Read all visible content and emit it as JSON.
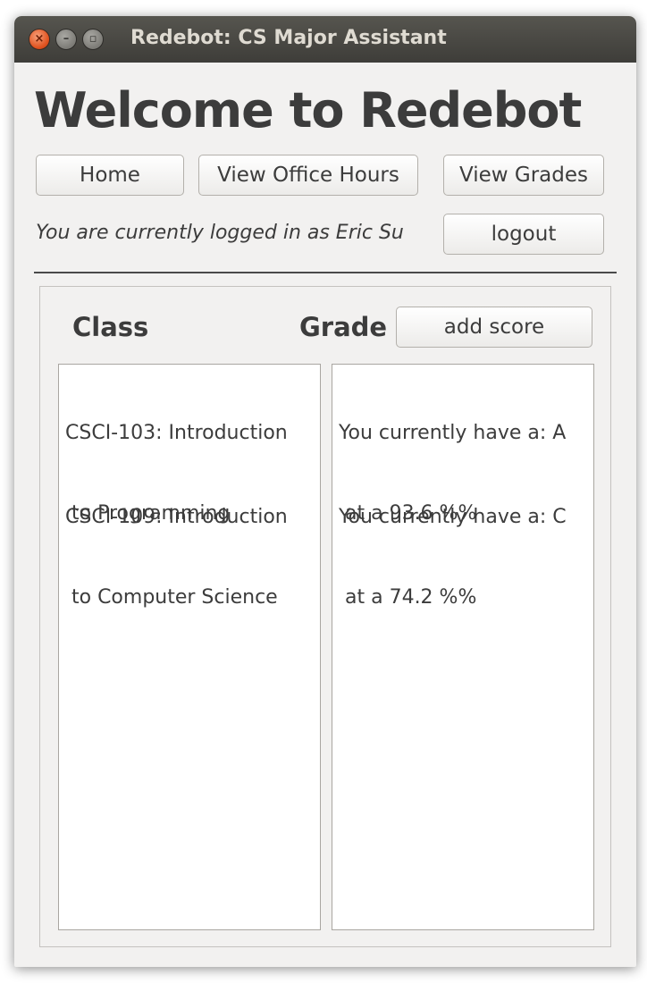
{
  "window": {
    "title": "Redebot: CS Major Assistant",
    "close_glyph": "×",
    "min_glyph": "–",
    "max_glyph": "▫"
  },
  "header": {
    "title": "Welcome to Redebot"
  },
  "nav": {
    "home_label": "Home",
    "office_hours_label": "View Office Hours",
    "grades_label": "View Grades",
    "logout_label": "logout"
  },
  "status": {
    "logged_in_text": "You are currently logged in as Eric Su"
  },
  "grades": {
    "class_header": "Class",
    "grade_header": "Grade",
    "add_score_label": "add score",
    "classes": [
      {
        "line1": "CSCI-103: Introduction",
        "line2": " to Programming"
      },
      {
        "line1": "CSCI-109: Introduction",
        "line2": " to Computer Science"
      }
    ],
    "grade_entries": [
      {
        "line1": "You currently have a: A",
        "line2": " at a 93.6 %%"
      },
      {
        "line1": "You currently have a: C",
        "line2": " at a 74.2 %%"
      }
    ]
  }
}
